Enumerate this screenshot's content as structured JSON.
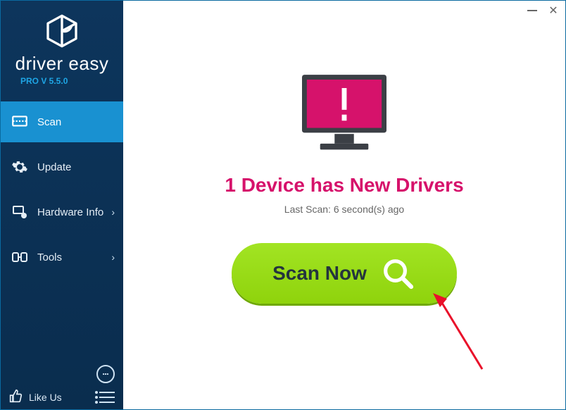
{
  "brand": {
    "name": "driver easy",
    "version": "PRO V 5.5.0"
  },
  "sidebar": {
    "items": [
      {
        "label": "Scan",
        "has_chevron": false,
        "active": true
      },
      {
        "label": "Update",
        "has_chevron": false,
        "active": false
      },
      {
        "label": "Hardware Info",
        "has_chevron": true,
        "active": false
      },
      {
        "label": "Tools",
        "has_chevron": true,
        "active": false
      }
    ],
    "like_label": "Like Us"
  },
  "main": {
    "status_title": "1 Device has New Drivers",
    "last_scan": "Last Scan: 6 second(s) ago",
    "scan_button_label": "Scan Now"
  },
  "colors": {
    "accent_pink": "#d6126b",
    "scan_green": "#97dd17",
    "sidebar_dark": "#0a2d4e",
    "sidebar_active": "#1991d1"
  }
}
